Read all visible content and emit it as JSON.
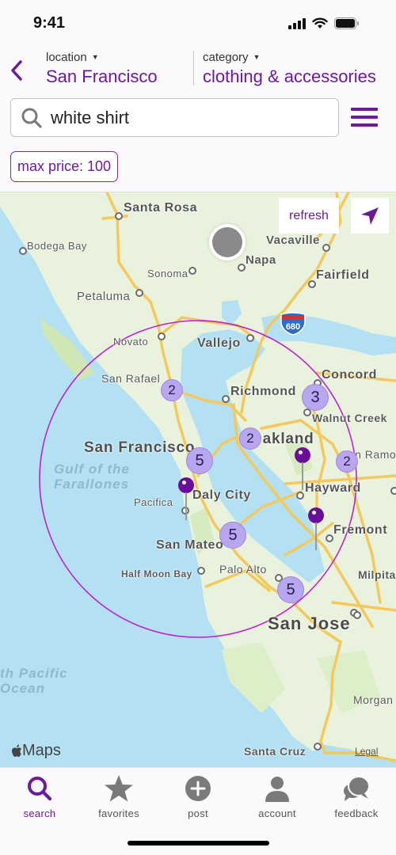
{
  "status_bar": {
    "time": "9:41",
    "icons": [
      "cellular-signal-icon",
      "wifi-icon",
      "battery-icon"
    ]
  },
  "nav": {
    "back_icon": "chevron-left-icon",
    "location": {
      "label": "location",
      "value": "San Francisco"
    },
    "category": {
      "label": "category",
      "value": "clothing & accessories"
    }
  },
  "search": {
    "icon": "search-icon",
    "value": "white shirt",
    "placeholder": ""
  },
  "menu_icon": "hamburger-menu-icon",
  "filters": [
    {
      "label": "max price: 100"
    }
  ],
  "map": {
    "refresh_label": "refresh",
    "locate_icon": "location-arrow-icon",
    "attribution": "Maps",
    "legal_label": "Legal",
    "highway_shield": "680",
    "labels": {
      "santa_rosa": "Santa Rosa",
      "bodega_bay": "Bodega Bay",
      "vacaville": "Vacaville",
      "napa": "Napa",
      "sonoma": "Sonoma",
      "fairfield": "Fairfield",
      "petaluma": "Petaluma",
      "novato": "Novato",
      "vallejo": "Vallejo",
      "concord": "Concord",
      "san_rafael": "San Rafael",
      "richmond": "Richmond",
      "walnut_creek": "Walnut Creek",
      "san_francisco": "San Francisco",
      "oakland": "Oakland",
      "san_ramon": "San Ramon",
      "gulf": "Gulf of the",
      "farallones": "Farallones",
      "pacifica": "Pacifica",
      "daly_city": "Daly City",
      "hayward": "Hayward",
      "fremont": "Fremont",
      "san_mateo": "San Mateo",
      "half_moon_bay": "Half Moon Bay",
      "palo_alto": "Palo Alto",
      "milpitas": "Milpitas",
      "san_jose": "San Jose",
      "pacific_1": "th Pacific",
      "pacific_2": "Ocean",
      "morgan": "Morgan",
      "santa_cruz": "Santa Cruz"
    },
    "clusters": [
      {
        "name": "san-rafael",
        "count": "2"
      },
      {
        "name": "walnut-creek",
        "count": "3"
      },
      {
        "name": "oakland",
        "count": "2"
      },
      {
        "name": "san-ramon",
        "count": "2"
      },
      {
        "name": "san-francisco",
        "count": "5"
      },
      {
        "name": "san-mateo",
        "count": "5"
      },
      {
        "name": "palo-alto",
        "count": "5"
      }
    ],
    "pins": 3,
    "accent_color": "#6a1b9a",
    "radius_color": "#c020d0"
  },
  "tab_bar": {
    "tabs": [
      {
        "label": "search",
        "icon": "search-icon",
        "active": true
      },
      {
        "label": "favorites",
        "icon": "star-icon",
        "active": false
      },
      {
        "label": "post",
        "icon": "plus-circle-icon",
        "active": false
      },
      {
        "label": "account",
        "icon": "person-icon",
        "active": false
      },
      {
        "label": "feedback",
        "icon": "chat-bubbles-icon",
        "active": false
      }
    ]
  }
}
